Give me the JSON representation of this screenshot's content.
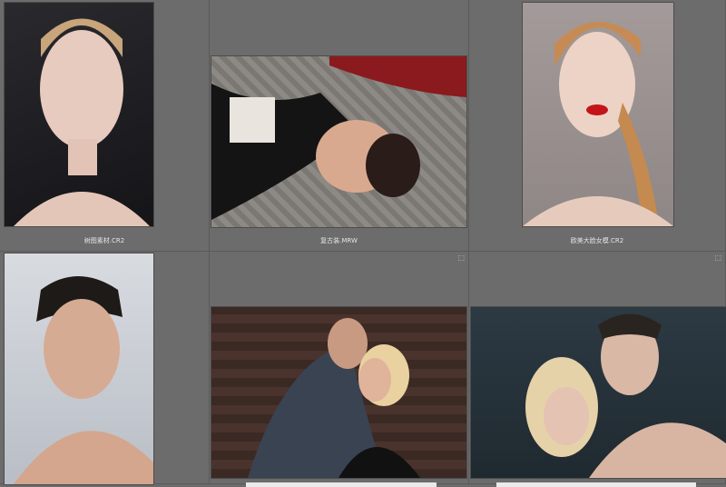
{
  "thumbnails": [
    {
      "filename": "树图素材.CR2",
      "badge": ""
    },
    {
      "filename": "复古装.MRW",
      "badge": ""
    },
    {
      "filename": "欧美大脸女模.CR2",
      "badge": ""
    },
    {
      "filename": "",
      "badge": "⬚"
    },
    {
      "filename": "",
      "badge": "⬚"
    },
    {
      "filename": "",
      "badge": ""
    }
  ],
  "colors": {
    "background": "#6b6b6b",
    "caption": "#e6e6e6"
  }
}
